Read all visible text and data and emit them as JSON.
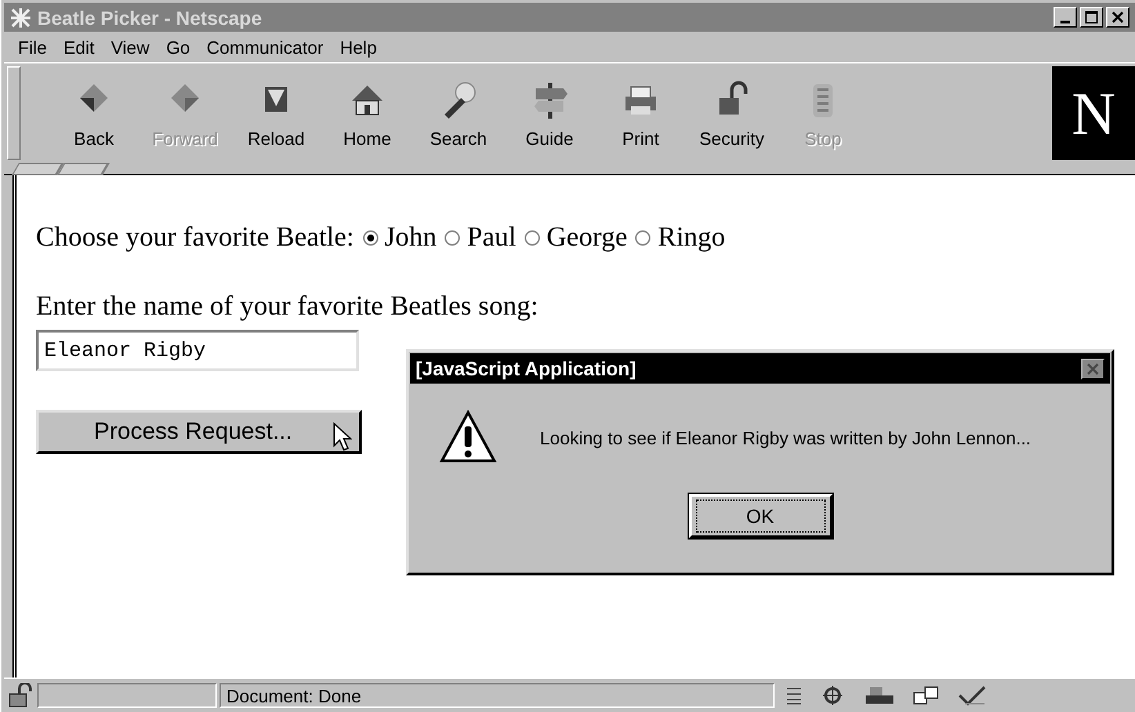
{
  "window": {
    "title": "Beatle Picker - Netscape"
  },
  "menu": [
    "File",
    "Edit",
    "View",
    "Go",
    "Communicator",
    "Help"
  ],
  "toolbar": [
    {
      "label": "Back",
      "disabled": false
    },
    {
      "label": "Forward",
      "disabled": true
    },
    {
      "label": "Reload",
      "disabled": false
    },
    {
      "label": "Home",
      "disabled": false
    },
    {
      "label": "Search",
      "disabled": false
    },
    {
      "label": "Guide",
      "disabled": false
    },
    {
      "label": "Print",
      "disabled": false
    },
    {
      "label": "Security",
      "disabled": false
    },
    {
      "label": "Stop",
      "disabled": true
    }
  ],
  "logo": "N",
  "page": {
    "question": "Choose your favorite Beatle:",
    "options": [
      {
        "label": "John",
        "selected": true
      },
      {
        "label": "Paul",
        "selected": false
      },
      {
        "label": "George",
        "selected": false
      },
      {
        "label": "Ringo",
        "selected": false
      }
    ],
    "song_label": "Enter the name of your favorite Beatles song:",
    "song_value": "Eleanor Rigby",
    "button": "Process Request..."
  },
  "dialog": {
    "title": "[JavaScript Application]",
    "message": "Looking to see if Eleanor Rigby was written by John Lennon...",
    "ok": "OK"
  },
  "status_bar": {
    "text": "Document: Done"
  }
}
